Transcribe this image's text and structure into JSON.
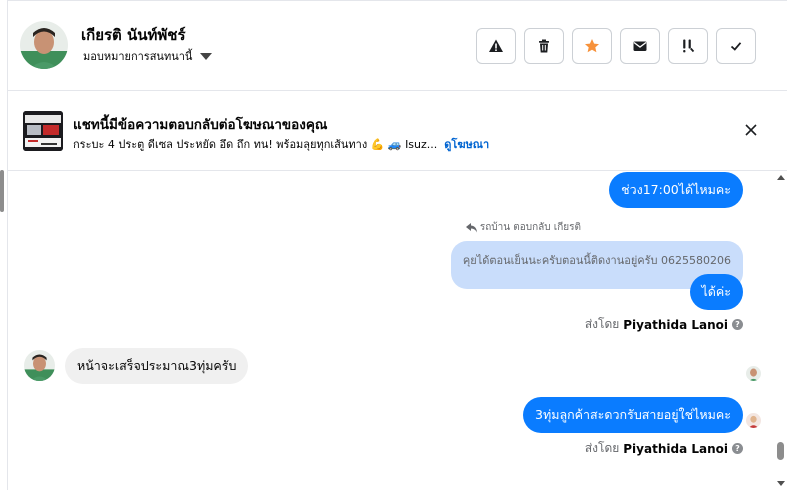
{
  "header": {
    "contact_name": "เกียรติ นันท์พัชร์",
    "assign_label": "มอบหมายการสนทนานี้",
    "tools": [
      {
        "name": "report-icon",
        "label": "รายงาน"
      },
      {
        "name": "trash-icon",
        "label": "ลบ"
      },
      {
        "name": "star-icon",
        "label": "ติดดาว"
      },
      {
        "name": "mail-icon",
        "label": "ทำเครื่องหมายว่ายังไม่อ่าน"
      },
      {
        "name": "follow-up-icon",
        "label": "ติดตามผล"
      },
      {
        "name": "check-icon",
        "label": "ทำเครื่องหมายว่าเสร็จ"
      }
    ]
  },
  "ad_banner": {
    "title": "แชทนี้มีข้อความตอบกลับต่อโฆษณาของคุณ",
    "subtitle": "กระบะ 4 ประตู ดีเซล ประหยัด อึด ถึก ทน! พร้อมลุยทุกเส้นทาง 💪 🚙 Isuz...",
    "link": "ดูโฆษณา"
  },
  "messages": {
    "m1": "ช่วง17:00ได้ไหมคะ",
    "reply_label": "รถบ้าน ตอบกลับ เกียรติ",
    "quoted": "คุยได้ตอนเย็นนะครับตอนนี้ติดงานอยู่ครับ 0625580206",
    "m2": "ได้ค่ะ",
    "sent_by_prefix": "ส่งโดย",
    "sender": "Piyathida Lanoi",
    "incoming": "หน้าจะเสร็จประมาณ3ทุ่มครับ",
    "m3": "3ทุ่มลูกค้าสะดวกรับสายอยู่ใช่ไหมคะ"
  },
  "colors": {
    "accent_blue": "#0a7cff",
    "quote_bg": "#c9ddfb",
    "incoming_bg": "#f0f0f0",
    "star_orange": "#f7923b",
    "link_blue": "#0064d1"
  }
}
